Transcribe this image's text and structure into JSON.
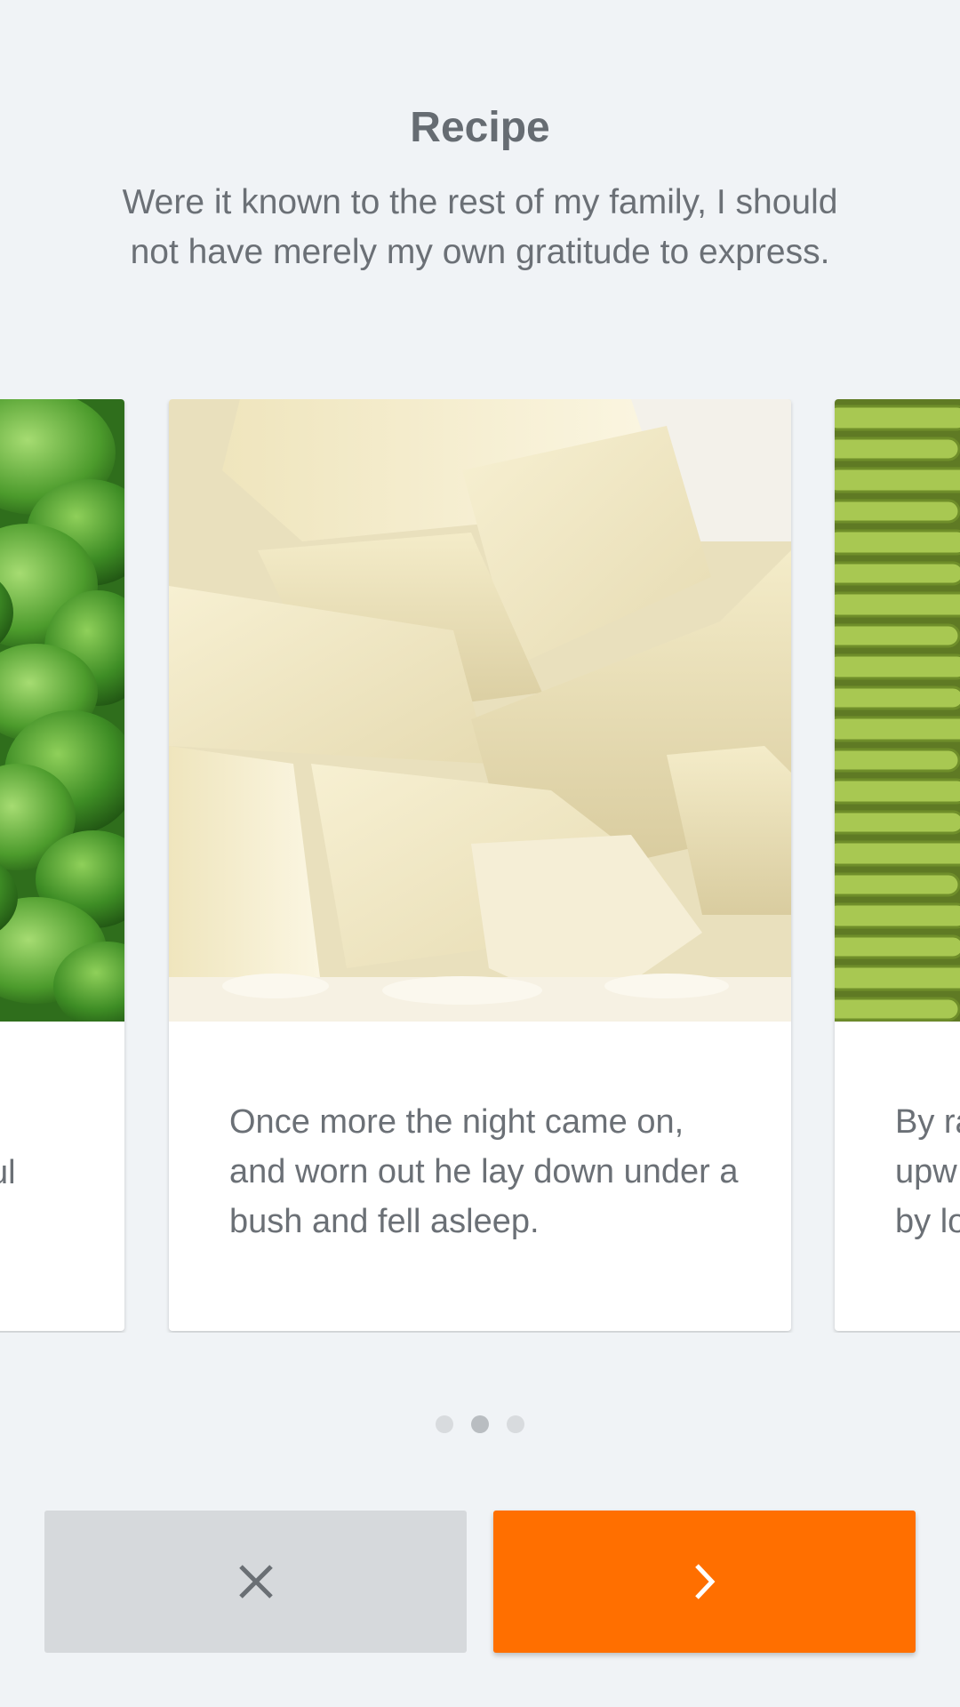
{
  "header": {
    "title": "Recipe",
    "subtitle": "Were it known to the rest of my family, I should not have merely my own gratitude to express."
  },
  "carousel": {
    "cards": [
      {
        "image": "leafy-greens-photo",
        "text_visible": "ul"
      },
      {
        "image": "white-chocolate-photo",
        "text": "Once more the night came on, and worn out he lay down under a bush and fell asleep."
      },
      {
        "image": "green-beans-photo",
        "text_visible": "By ra\nupw\nby lo"
      }
    ],
    "page_count": 3,
    "active_index": 1
  },
  "actions": {
    "cancel_icon": "close-icon",
    "next_icon": "chevron-right-icon"
  },
  "colors": {
    "background": "#f0f3f6",
    "accent": "#ff6f00",
    "cancel_button": "#d6d9dc",
    "text": "#6b7076"
  }
}
